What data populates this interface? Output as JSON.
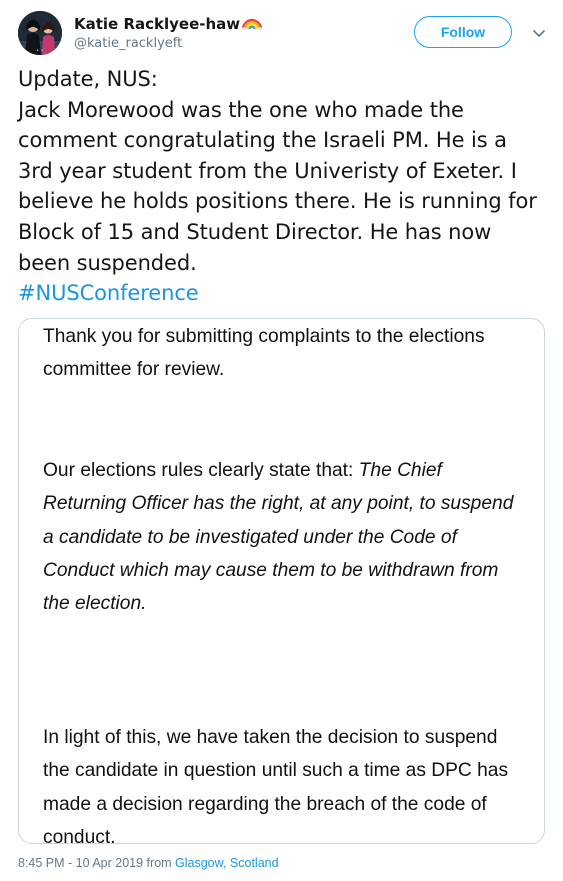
{
  "user": {
    "display_name": "Katie Racklyee-haw",
    "emoji": "rainbow-icon",
    "handle": "@katie_racklyeft"
  },
  "follow_button": {
    "label": "Follow"
  },
  "more_menu": {
    "icon": "chevron-down-icon"
  },
  "tweet": {
    "line1": "Update, NUS:",
    "body": "Jack Morewood was the one who made the comment congratulating the Israeli PM. He is a 3rd year student from the Univeristy of Exeter. I believe he holds positions there. He is running for Block of 15 and Student Director. He has now been suspended.",
    "hashtag": "#NUSConference"
  },
  "media": {
    "para1": "Thank you for submitting complaints to the elections committee for review.",
    "para2_lead": "Our elections rules clearly state that: ",
    "para2_italic": "The Chief Returning Officer has the right, at any point, to suspend a candidate to be investigated under the Code of Conduct which may cause them to be withdrawn from the election.",
    "para3": "In light of this, we have taken the decision to suspend the candidate in question until such a time as DPC has made a decision regarding the breach of the code of conduct."
  },
  "footer": {
    "time": "8:45 PM - 10 Apr 2019 from ",
    "place": "Glasgow, Scotland"
  },
  "colors": {
    "accent": "#1da1f2",
    "link": "#1b95e0",
    "muted": "#657786",
    "border": "#ccd6dd"
  }
}
